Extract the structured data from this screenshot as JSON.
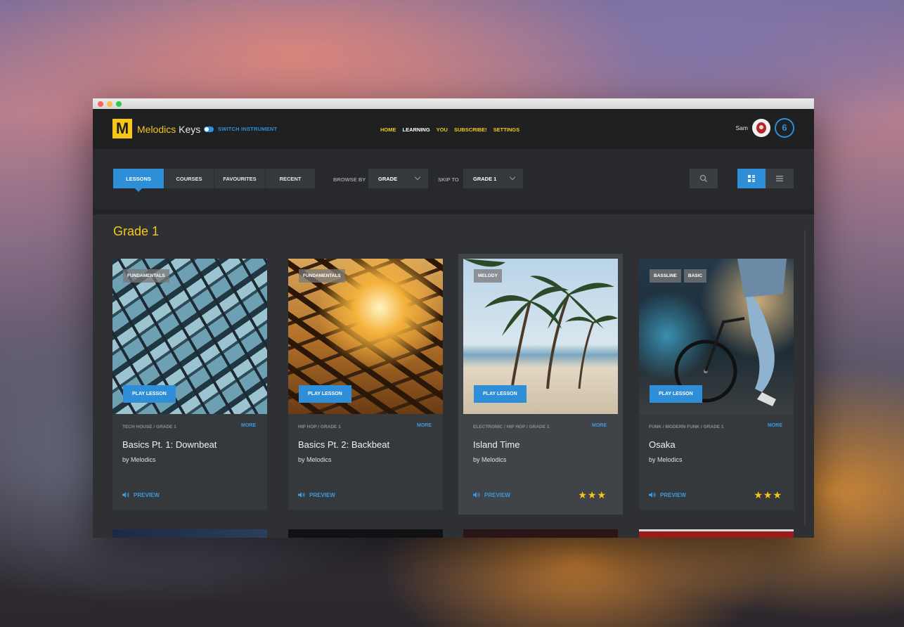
{
  "app": {
    "logo_letter": "M",
    "brand_name": "Melodics",
    "brand_product": "Keys",
    "switch_label": "SWITCH INSTRUMENT",
    "accent": "#f7c718",
    "blue": "#2f8ed8"
  },
  "nav": {
    "items": [
      {
        "label": "HOME"
      },
      {
        "label": "LEARNING"
      },
      {
        "label": "YOU"
      },
      {
        "label": "SUBSCRIBE!"
      },
      {
        "label": "SETTINGS"
      }
    ]
  },
  "user": {
    "name": "Sam",
    "level": "6"
  },
  "filters": {
    "tabs": [
      {
        "label": "LESSONS"
      },
      {
        "label": "COURSES"
      },
      {
        "label": "FAVOURITES"
      },
      {
        "label": "RECENT"
      }
    ],
    "browse_label": "BROWSE BY",
    "browse_value": "GRADE",
    "skip_label": "SKIP TO",
    "skip_value": "GRADE 1",
    "search_icon": "search-icon",
    "grid_icon": "grid-view-icon",
    "list_icon": "list-view-icon"
  },
  "section": {
    "title": "Grade 1"
  },
  "lessons": [
    {
      "tags": [
        "FUNDAMENTALS"
      ],
      "play_label": "PLAY LESSON",
      "meta": "TECH HOUSE / GRADE 1",
      "more_label": "MORE",
      "title": "Basics Pt. 1: Downbeat",
      "author": "by Melodics",
      "preview_label": "PREVIEW",
      "stars": ""
    },
    {
      "tags": [
        "FUNDAMENTALS"
      ],
      "play_label": "PLAY LESSON",
      "meta": "HIP HOP / GRADE 1",
      "more_label": "MORE",
      "title": "Basics Pt. 2: Backbeat",
      "author": "by Melodics",
      "preview_label": "PREVIEW",
      "stars": ""
    },
    {
      "tags": [
        "MELODY"
      ],
      "play_label": "PLAY LESSON",
      "meta": "ELECTRONIC / HIP HOP / GRADE 1",
      "more_label": "MORE",
      "title": "Island Time",
      "author": "by Melodics",
      "preview_label": "PREVIEW",
      "stars": "★★★"
    },
    {
      "tags": [
        "BASSLINE",
        "BASIC"
      ],
      "play_label": "PLAY LESSON",
      "meta": "FUNK / MODERN FUNK / GRADE 1",
      "more_label": "MORE",
      "title": "Osaka",
      "author": "by Melodics",
      "preview_label": "PREVIEW",
      "stars": "★★★"
    }
  ]
}
